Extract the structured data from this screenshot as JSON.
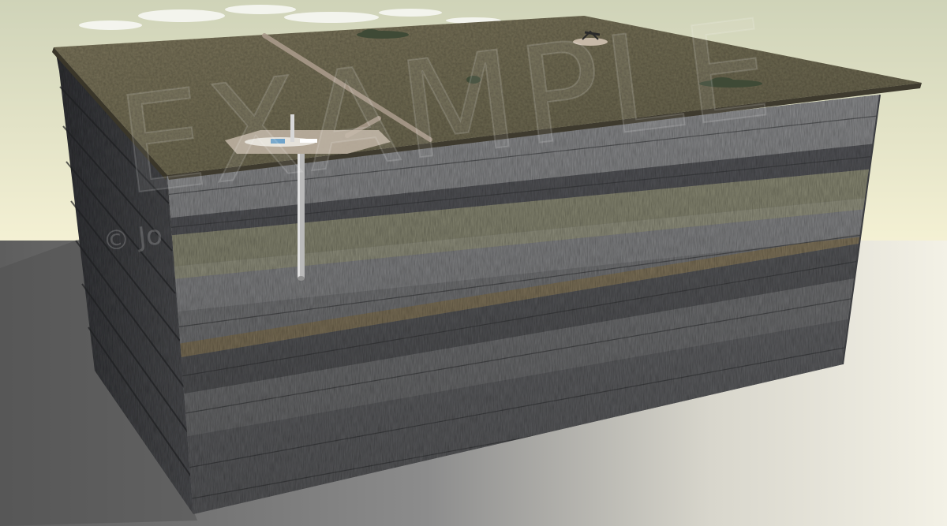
{
  "watermark": {
    "main_text": "EXAMPLE",
    "copyright_text": "© Jo"
  },
  "colors": {
    "sky_top": "#cfd3b8",
    "sky_horizon": "#f7f3d6",
    "ground_shadow": "#6e6e6e",
    "surface_top": "#6f6a52",
    "rock_dark": "#55565a",
    "rock_mid": "#7d7e80",
    "rock_light": "#9a9b9c",
    "sand_layer": "#8e8e78",
    "amber_seam": "#8a7d62",
    "well_casing": "#b9b9b9",
    "road": "#a8998a",
    "vegetation": "#3f4a36"
  },
  "icons": {
    "drilling_rig": "drilling-rig-icon",
    "pump_jack": "pumpjack-icon",
    "shrub": "shrub-icon"
  }
}
